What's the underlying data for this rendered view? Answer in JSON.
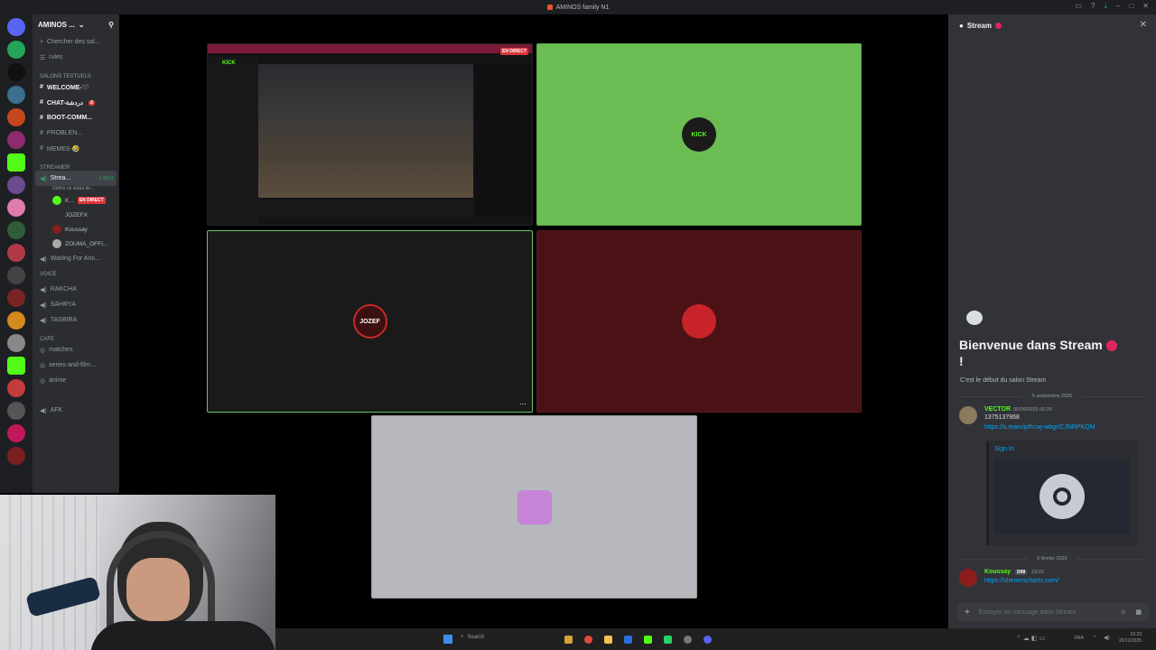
{
  "window": {
    "title": "AMINOS family N1"
  },
  "server": {
    "name": "AMINOS ...",
    "channels": [
      {
        "label": "Chercher des sal...",
        "kind": "search"
      },
      {
        "label": "rules",
        "kind": "text"
      }
    ],
    "text_category": "Salons textuels",
    "text_channels": [
      {
        "label": "WELCOME-🖤",
        "bold": true
      },
      {
        "label": "CHAT-دردشة",
        "bold": true,
        "badge": "3"
      },
      {
        "label": "BOOT-COMM...",
        "bold": true
      },
      {
        "label": "PROBLEN...",
        "bold": false
      },
      {
        "label": "MEMES-🤣",
        "bold": false
      }
    ],
    "streamer_category": "STREAMER",
    "stream_channel": {
      "label": "Strea...",
      "time": "1:08:01",
      "sub": "Définir un statut de..."
    },
    "stream_users": [
      {
        "label": "K...",
        "live": "EN DIRECT"
      },
      {
        "label": "JOZEFX"
      },
      {
        "label": "Koussay"
      },
      {
        "label": "ZOUMA_OFFI..."
      }
    ],
    "voice_channels": [
      {
        "label": "Waiting For Ami..."
      },
      {
        "label": "VOICE"
      },
      {
        "label": "RAKCHA"
      },
      {
        "label": "SAHRYA"
      },
      {
        "label": "TASBIRA"
      }
    ],
    "cafe_category": "CAFE",
    "cafe_channels": [
      {
        "label": "matches"
      },
      {
        "label": "series-and-film..."
      },
      {
        "label": "anime"
      }
    ],
    "extra_channels": [
      {
        "label": "AFK"
      }
    ]
  },
  "stream_grid": {
    "tiles": [
      {
        "name": "screen-share",
        "live_label": "EN DIRECT",
        "kick_logo": "KICK"
      },
      {
        "name": "kick-user",
        "avatar_label": "KICK",
        "bg": "#6bbd53"
      },
      {
        "name": "jozefx",
        "avatar_label": "JOZEF",
        "bg": "#1a1a1a"
      },
      {
        "name": "red-user",
        "bg": "#4a1214"
      },
      {
        "name": "purple-user",
        "bg": "#b6b8bd"
      }
    ]
  },
  "right_panel": {
    "header": "Stream",
    "welcome_title": "Bienvenue dans Stream",
    "welcome_line2": "!",
    "welcome_sub": "C'est le début du salon Stream",
    "divider1": "5 septembre 2025",
    "msg1": {
      "author": "VECTOR",
      "time": "05/09/2025 00:26",
      "text": "1375137868",
      "link": "https://s.team/p/hcwj-wbgr/CJNRPKQM",
      "embed_label": "Sign In"
    },
    "divider2": "6 février 2026",
    "msg2": {
      "author": "Koussay",
      "tag": "D99",
      "time": "23:21",
      "link": "https://streamscharts.com/"
    },
    "composer_placeholder": "Envoyer un message dans Stream"
  },
  "taskbar": {
    "search": "Search",
    "lang": "FRA",
    "clock_time": "23:23",
    "clock_date": "26/12/2025"
  },
  "colors": {
    "kick_green": "#53fc18",
    "discord_bg": "#313338",
    "live_red": "#da373c",
    "link_blue": "#00a8fc"
  }
}
